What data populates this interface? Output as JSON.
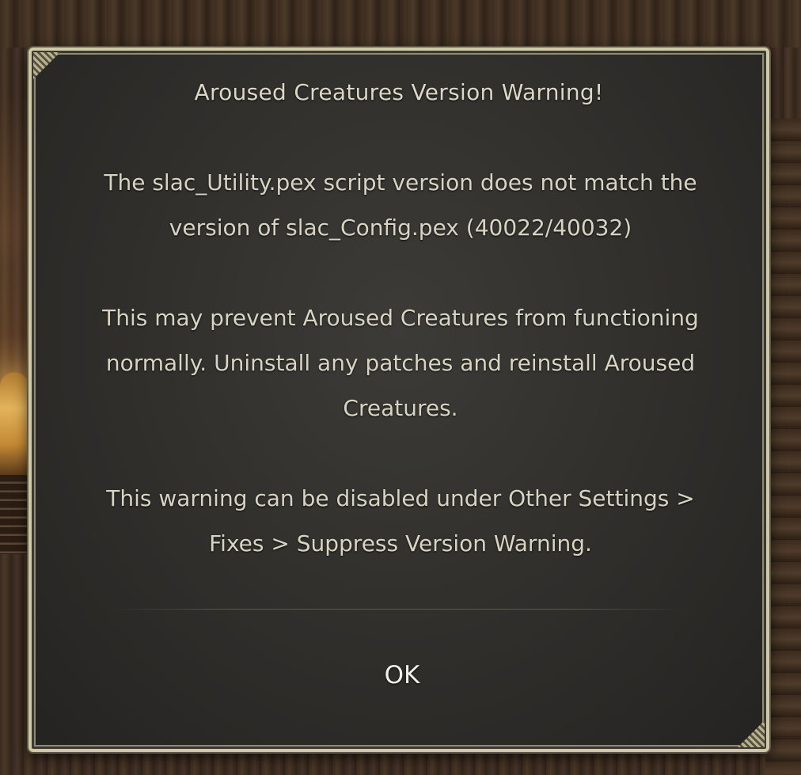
{
  "dialog": {
    "title": "Aroused Creatures Version Warning!",
    "paragraphs": [
      "The slac_Utility.pex script version does not match the version of slac_Config.pex (40022/40032)",
      "This may prevent Aroused Creatures from functioning normally. Uninstall any patches and reinstall Aroused Creatures.",
      "This warning can be disabled under Other Settings > Fixes > Suppress Version Warning."
    ],
    "ok_label": "OK"
  },
  "colors": {
    "border": "#cfc9a8",
    "panel": "#2f2e2b",
    "text": "#d8d4c4"
  }
}
